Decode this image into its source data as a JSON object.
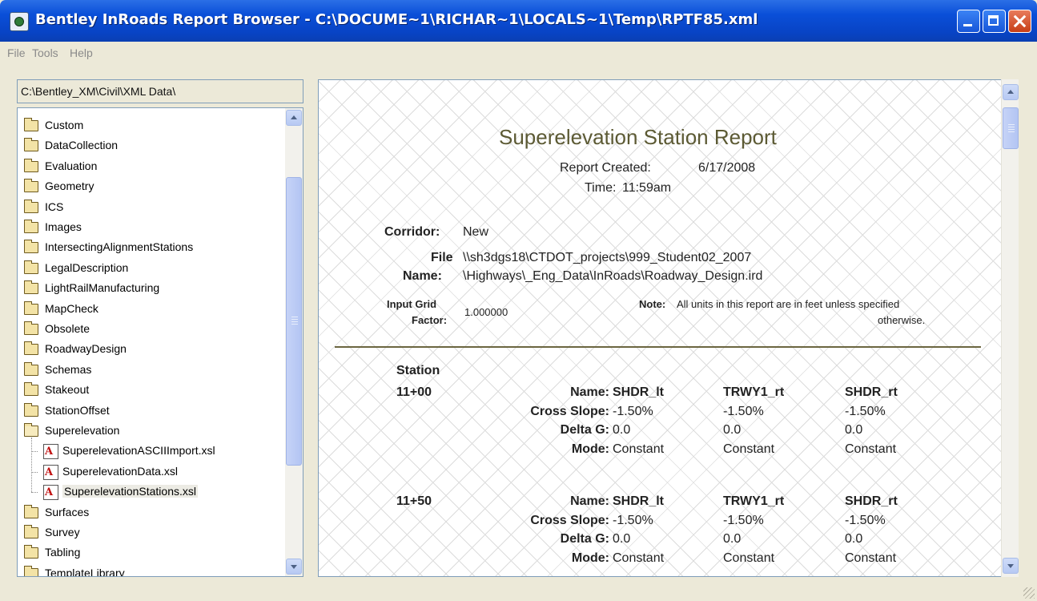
{
  "window": {
    "title": "Bentley InRoads Report Browser - C:\\DOCUME~1\\RICHAR~1\\LOCALS~1\\Temp\\RPTF85.xml"
  },
  "menu": [
    "File",
    "Tools",
    "Help"
  ],
  "browser": {
    "path": "C:\\Bentley_XM\\Civil\\XML Data\\",
    "tree": [
      {
        "label": "Custom",
        "type": "folder"
      },
      {
        "label": "DataCollection",
        "type": "folder"
      },
      {
        "label": "Evaluation",
        "type": "folder"
      },
      {
        "label": "Geometry",
        "type": "folder"
      },
      {
        "label": "ICS",
        "type": "folder"
      },
      {
        "label": "Images",
        "type": "folder"
      },
      {
        "label": "IntersectingAlignmentStations",
        "type": "folder"
      },
      {
        "label": "LegalDescription",
        "type": "folder"
      },
      {
        "label": "LightRailManufacturing",
        "type": "folder"
      },
      {
        "label": "MapCheck",
        "type": "folder"
      },
      {
        "label": "Obsolete",
        "type": "folder"
      },
      {
        "label": "RoadwayDesign",
        "type": "folder"
      },
      {
        "label": "Schemas",
        "type": "folder"
      },
      {
        "label": "Stakeout",
        "type": "folder"
      },
      {
        "label": "StationOffset",
        "type": "folder"
      },
      {
        "label": "Superelevation",
        "type": "folder-open"
      },
      {
        "label": "SuperelevationASCIIImport.xsl",
        "type": "xsl"
      },
      {
        "label": "SuperelevationData.xsl",
        "type": "xsl"
      },
      {
        "label": "SuperelevationStations.xsl",
        "type": "xsl",
        "selected": true
      },
      {
        "label": "Surfaces",
        "type": "folder"
      },
      {
        "label": "Survey",
        "type": "folder"
      },
      {
        "label": "Tabling",
        "type": "folder"
      },
      {
        "label": "TemplateLibrary",
        "type": "folder"
      }
    ]
  },
  "report": {
    "title": "Superelevation Station Report",
    "created_label": "Report Created:",
    "created_value": "6/17/2008",
    "time_label": "Time:",
    "time_value": "11:59am",
    "corridor_label": "Corridor:",
    "corridor_value": "New",
    "file_label_1": "File",
    "file_label_2": "Name:",
    "file_value_1": "\\\\sh3dgs18\\CTDOT_projects\\999_Student02_2007",
    "file_value_2": "\\Highways\\_Eng_Data\\InRoads\\Roadway_Design.ird",
    "grid_label_1": "Input Grid",
    "grid_label_2": "Factor:",
    "grid_value": "1.000000",
    "note_label": "Note:",
    "note_text_1": "All units in this report are in feet unless specified",
    "note_text_2": "otherwise.",
    "station_header": "Station",
    "row_labels": [
      "Name:",
      "Cross Slope:",
      "Delta G:",
      "Mode:"
    ],
    "stations": [
      {
        "station": "11+00",
        "columns": [
          {
            "name": "SHDR_lt",
            "cross_slope": "-1.50%",
            "delta_g": "0.0",
            "mode": "Constant"
          },
          {
            "name": "TRWY1_rt",
            "cross_slope": "-1.50%",
            "delta_g": "0.0",
            "mode": "Constant"
          },
          {
            "name": "SHDR_rt",
            "cross_slope": "-1.50%",
            "delta_g": "0.0",
            "mode": "Constant"
          }
        ]
      },
      {
        "station": "11+50",
        "columns": [
          {
            "name": "SHDR_lt",
            "cross_slope": "-1.50%",
            "delta_g": "0.0",
            "mode": "Constant"
          },
          {
            "name": "TRWY1_rt",
            "cross_slope": "-1.50%",
            "delta_g": "0.0",
            "mode": "Constant"
          },
          {
            "name": "SHDR_rt",
            "cross_slope": "-1.50%",
            "delta_g": "0.0",
            "mode": "Constant"
          }
        ]
      }
    ]
  },
  "colors": {
    "titlebar": "#0a4fd8",
    "report_title": "#5c5a34",
    "divider": "#6b6640"
  }
}
